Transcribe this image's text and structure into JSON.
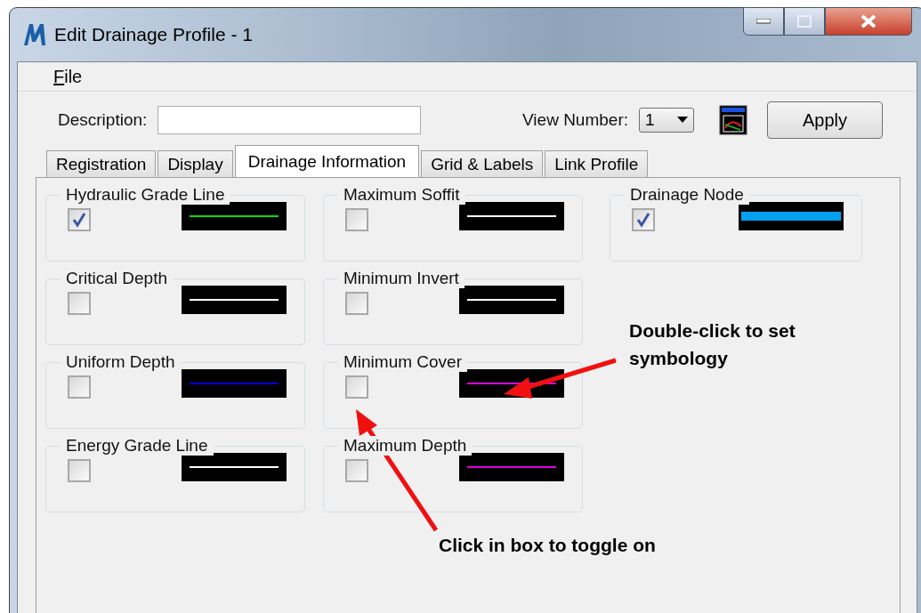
{
  "window": {
    "title": "Edit Drainage Profile - 1"
  },
  "menu": [
    "File"
  ],
  "description": {
    "label": "Description:"
  },
  "view_number": {
    "label": "View Number:",
    "value": "1"
  },
  "apply_button": "Apply",
  "tabs": [
    {
      "label": "Registration",
      "selected": false
    },
    {
      "label": "Display",
      "selected": false
    },
    {
      "label": "Drainage Information",
      "selected": true
    },
    {
      "label": "Grid & Labels",
      "selected": false
    },
    {
      "label": "Link Profile",
      "selected": false
    }
  ],
  "columns": [
    [
      {
        "label": "Hydraulic Grade Line",
        "checked": true,
        "kind": "line",
        "color": "#00e000"
      },
      {
        "label": "Critical Depth",
        "checked": false,
        "kind": "line",
        "color": "#ffffff"
      },
      {
        "label": "Uniform Depth",
        "checked": false,
        "kind": "line",
        "color": "#0000e0"
      },
      {
        "label": "Energy Grade Line",
        "checked": false,
        "kind": "line",
        "color": "#ffffff"
      }
    ],
    [
      {
        "label": "Maximum Soffit",
        "checked": false,
        "kind": "line",
        "color": "#ffffff"
      },
      {
        "label": "Minimum Invert",
        "checked": false,
        "kind": "line",
        "color": "#ffffff"
      },
      {
        "label": "Minimum Cover",
        "checked": false,
        "kind": "line",
        "color": "#e000e0"
      },
      {
        "label": "Maximum Depth",
        "checked": false,
        "kind": "line",
        "color": "#e000e0"
      }
    ],
    [
      {
        "label": "Drainage Node",
        "checked": true,
        "kind": "bar",
        "color": "#00a0f0"
      }
    ]
  ],
  "annotations": [
    {
      "text": "Double-click to set symbology"
    },
    {
      "text": "Click in box to toggle on"
    }
  ]
}
